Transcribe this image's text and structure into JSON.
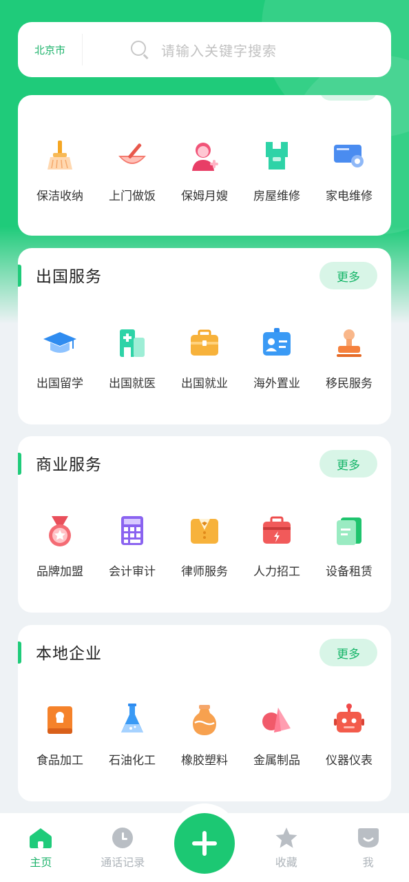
{
  "search": {
    "city": "北京市",
    "placeholder": "请输入关键字搜索"
  },
  "sections": [
    {
      "title": "",
      "more": "",
      "items": [
        {
          "label": "保洁收纳",
          "icon": "broom-icon"
        },
        {
          "label": "上门做饭",
          "icon": "cooking-bowl-icon"
        },
        {
          "label": "保姆月嫂",
          "icon": "nanny-icon"
        },
        {
          "label": "房屋维修",
          "icon": "house-repair-icon"
        },
        {
          "label": "家电维修",
          "icon": "appliance-repair-icon"
        }
      ]
    },
    {
      "title": "出国服务",
      "more": "更多",
      "items": [
        {
          "label": "出国留学",
          "icon": "graduation-cap-icon"
        },
        {
          "label": "出国就医",
          "icon": "hospital-icon"
        },
        {
          "label": "出国就业",
          "icon": "briefcase-icon"
        },
        {
          "label": "海外置业",
          "icon": "id-card-icon"
        },
        {
          "label": "移民服务",
          "icon": "stamp-icon"
        }
      ]
    },
    {
      "title": "商业服务",
      "more": "更多",
      "items": [
        {
          "label": "品牌加盟",
          "icon": "medal-icon"
        },
        {
          "label": "会计审计",
          "icon": "calculator-icon"
        },
        {
          "label": "律师服务",
          "icon": "suit-icon"
        },
        {
          "label": "人力招工",
          "icon": "toolbox-icon"
        },
        {
          "label": "设备租赁",
          "icon": "document-icon"
        }
      ]
    },
    {
      "title": "本地企业",
      "more": "更多",
      "items": [
        {
          "label": "食品加工",
          "icon": "food-book-icon"
        },
        {
          "label": "石油化工",
          "icon": "flask-icon"
        },
        {
          "label": "橡胶塑料",
          "icon": "vase-icon"
        },
        {
          "label": "金属制品",
          "icon": "crystal-icon"
        },
        {
          "label": "仪器仪表",
          "icon": "robot-icon"
        }
      ]
    }
  ],
  "tabbar": {
    "home": "主页",
    "calls": "通话记录",
    "favorites": "收藏",
    "me": "我"
  },
  "colors": {
    "brand": "#1fcb7a",
    "brand_text": "#1db36b",
    "more_bg": "#d8f5e7",
    "page_bg": "#eef2f5"
  }
}
